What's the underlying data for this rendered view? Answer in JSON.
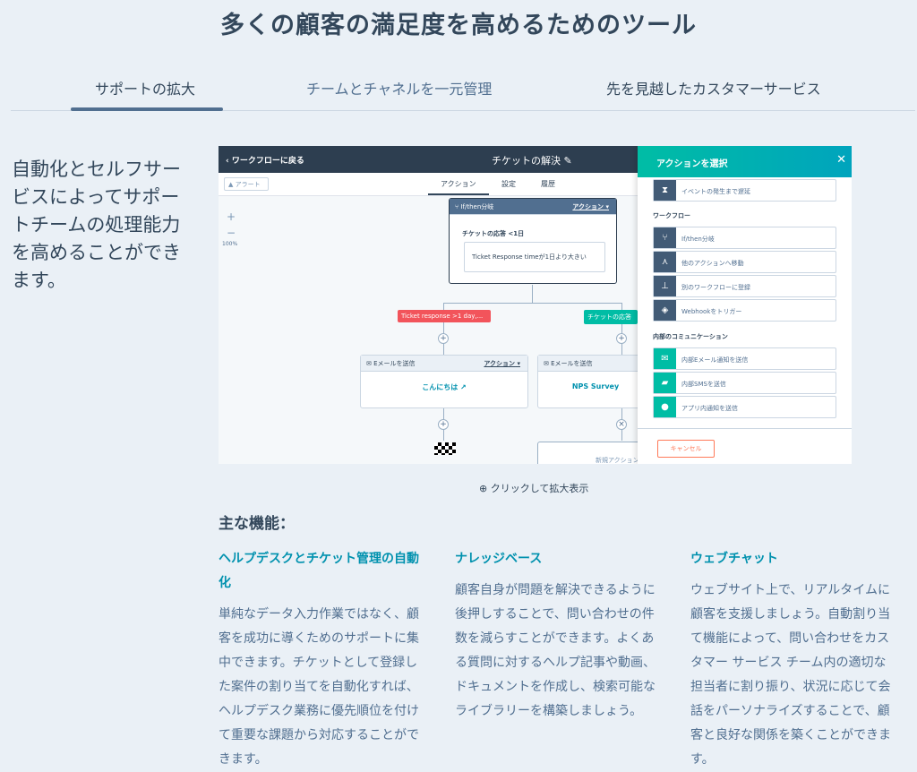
{
  "title": "多くの顧客の満足度を高めるためのツール",
  "tabs": [
    "サポートの拡大",
    "チームとチャネルを一元管理",
    "先を見越したカスタマーサービス"
  ],
  "lead": "自動化とセルフサービスによってサポートチームの処理能力を高めることができます。",
  "screenshot": {
    "back": "ワークフローに戻る",
    "workflow_title": "チケットの解決",
    "alert": "アラート",
    "subtabs": [
      "アクション",
      "設定",
      "履歴"
    ],
    "zoom_in": "+",
    "zoom_out": "−",
    "zoom_pct": "100%",
    "ifthen_label": "If/then分岐",
    "action_label": "アクション",
    "condition_title": "チケットの応答 <1日",
    "condition_text": "Ticket Response timeが1日より大きい",
    "branch_red": "Ticket response >1 day,...",
    "branch_teal": "チケットの応答",
    "email_label": "Eメールを送信",
    "email1_body": "こんにちは",
    "email2_body": "NPS Survey",
    "new_action": "新規アクション",
    "panel": {
      "title": "アクションを選択",
      "close": "✕",
      "item_delay": "イベントの発生まで遅延",
      "section_workflow": "ワークフロー",
      "items_workflow": [
        "If/then分岐",
        "他のアクションへ移動",
        "別のワークフローに登録",
        "Webhookをトリガー"
      ],
      "section_internal": "内部のコミュニケーション",
      "items_internal": [
        "内部Eメール通知を送信",
        "内部SMSを送信",
        "アプリ内通知を送信"
      ],
      "cancel": "キャンセル"
    }
  },
  "zoom_link": "クリックして拡大表示",
  "features_heading": "主な機能：",
  "features": [
    {
      "title": "ヘルプデスクとチケット管理の自動化",
      "desc": "単純なデータ入力作業ではなく、顧客を成功に導くためのサポートに集中できます。チケットとして登録した案件の割り当てを自動化すれば、ヘルプデスク業務に優先順位を付けて重要な課題から対応することができます。"
    },
    {
      "title": "ナレッジベース",
      "desc": "顧客自身が問題を解決できるように後押しすることで、問い合わせの件数を減らすことができます。よくある質問に対するヘルプ記事や動画、ドキュメントを作成し、検索可能なライブラリーを構築しましょう。"
    },
    {
      "title": "ウェブチャット",
      "desc": "ウェブサイト上で、リアルタイムに顧客を支援しましょう。自動割り当て機能によって、問い合わせをカスタマー サービス チーム内の適切な担当者に割り振り、状況に応じて会話をパーソナライズすることで、顧客と良好な関係を築くことができます。"
    }
  ]
}
